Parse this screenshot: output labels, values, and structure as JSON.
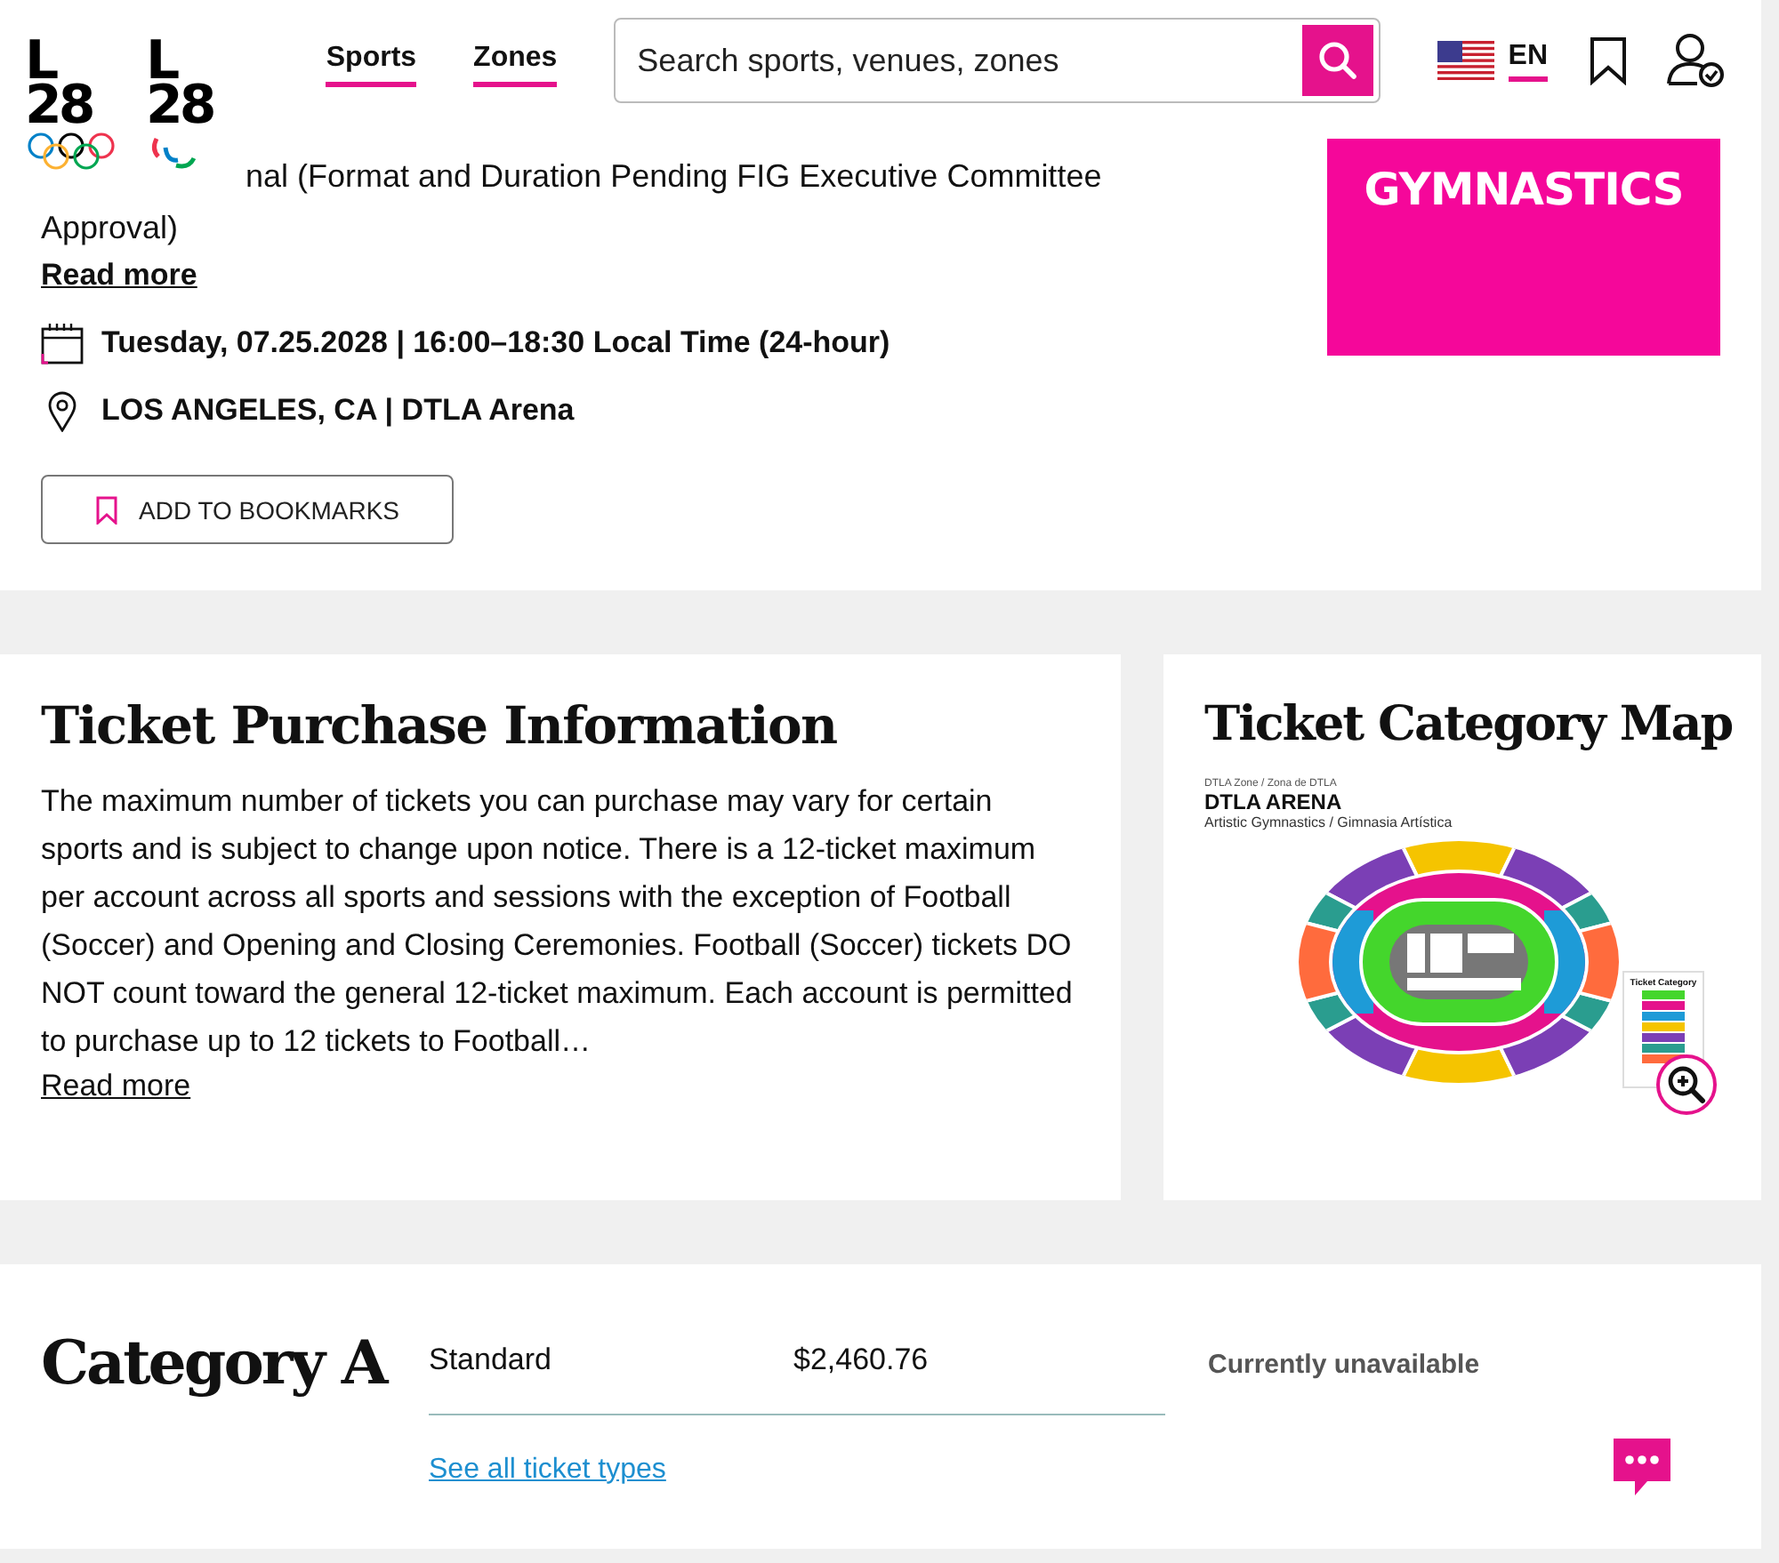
{
  "header": {
    "logos": [
      {
        "kind": "olympic",
        "letter": "L",
        "number": "28"
      },
      {
        "kind": "paralympic",
        "letter": "L",
        "number": "28"
      }
    ],
    "nav": [
      {
        "label": "Sports",
        "selected": true
      },
      {
        "label": "Zones",
        "selected": true
      }
    ],
    "search": {
      "placeholder": "Search sports, venues, zones"
    },
    "language": {
      "code": "EN",
      "selected": true
    }
  },
  "event": {
    "description": "nal (Format and Duration Pending FIG Executive Committee Approval)",
    "read_more": "Read more",
    "date": "Tuesday, 07.25.2028 | 16:00–18:30 Local Time (24-hour)",
    "location": "LOS ANGELES, CA | DTLA Arena",
    "bookmark_button": "ADD TO BOOKMARKS",
    "poster_title": "GYMNASTICS"
  },
  "ticket_info": {
    "title": "Ticket Purchase Information",
    "body": "The maximum number of tickets you can purchase may vary for certain sports and is subject to change upon notice. There is a 12-ticket maximum per account across all sports and sessions with the exception of Football (Soccer) and Opening and Closing Ceremonies. Football (Soccer) tickets DO NOT count toward the general 12-ticket maximum. Each account is permitted to purchase up to 12 tickets to Football…",
    "read_more": "Read more"
  },
  "category_map": {
    "title": "Ticket Category Map",
    "zone": "DTLA Zone / Zona de DTLA",
    "venue": "DTLA ARENA",
    "sport": "Artistic Gymnastics / Gimnasia Artística",
    "legend": {
      "title": "Ticket Category",
      "items": [
        {
          "color": "#44d62c"
        },
        {
          "color": "#e5128c"
        },
        {
          "color": "#1e9bd7"
        },
        {
          "color": "#f5c400"
        },
        {
          "color": "#7b3fb5"
        },
        {
          "color": "#2a9d8f"
        },
        {
          "color": "#ff6b3d"
        }
      ]
    }
  },
  "categories": [
    {
      "name": "Category A",
      "ticket_type": "Standard",
      "price": "$2,460.76",
      "availability": "Currently unavailable",
      "link": "See all ticket types"
    }
  ]
}
